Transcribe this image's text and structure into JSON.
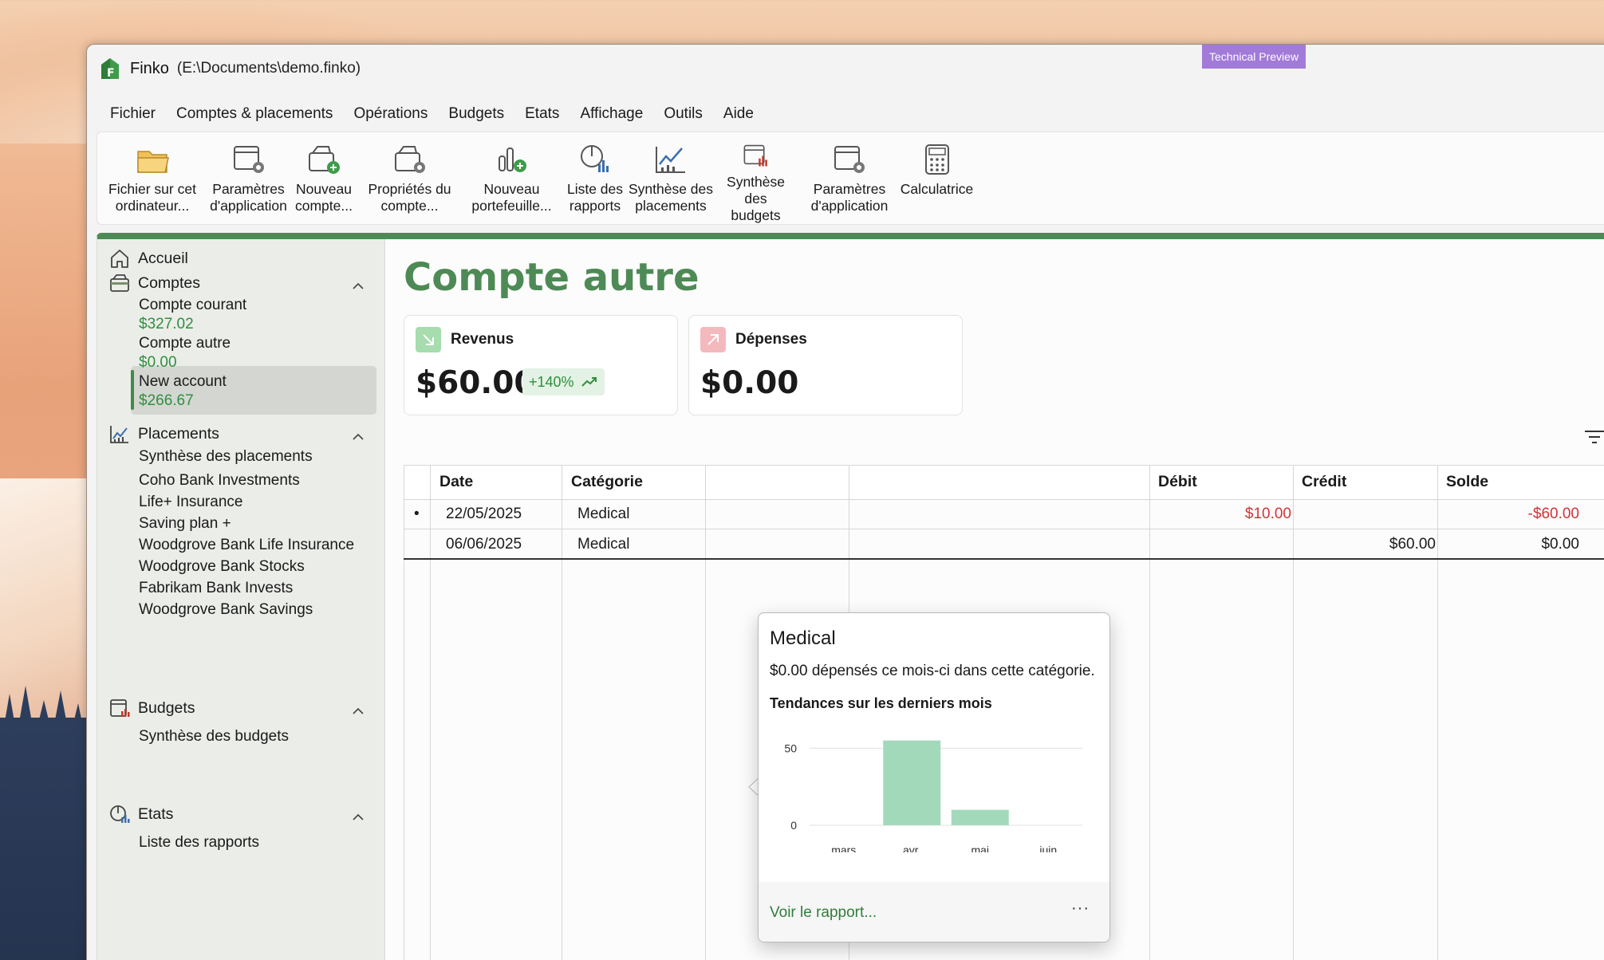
{
  "window": {
    "app_name": "Finko",
    "file_path": "(E:\\Documents\\demo.finko)",
    "badge": "Technical Preview"
  },
  "menu": [
    "Fichier",
    "Comptes & placements",
    "Opérations",
    "Budgets",
    "Etats",
    "Affichage",
    "Outils",
    "Aide"
  ],
  "ribbon": [
    {
      "label": "Fichier sur cet\nordinateur...",
      "icon": "folder-icon"
    },
    {
      "label": "Paramètres\nd'application",
      "icon": "window-gear-icon"
    },
    {
      "label": "Nouveau\ncompte...",
      "icon": "wallet-add-icon"
    },
    {
      "label": "Propriétés du\ncompte...",
      "icon": "wallet-gear-icon"
    },
    {
      "label": "Nouveau\nportefeuille...",
      "icon": "portfolio-add-icon"
    },
    {
      "label": "Liste des\nrapports",
      "icon": "report-chart-icon"
    },
    {
      "label": "Synthèse des\nplacements",
      "icon": "trend-chart-icon"
    },
    {
      "label": "Synthèse des\nbudgets",
      "icon": "budget-chart-icon"
    },
    {
      "label": "Paramètres\nd'application",
      "icon": "window-gear-icon"
    },
    {
      "label": "Calculatrice",
      "icon": "calculator-icon"
    }
  ],
  "sidebar": {
    "home": "Accueil",
    "accounts_title": "Comptes",
    "accounts": [
      {
        "name": "Compte courant",
        "balance": "$327.02"
      },
      {
        "name": "Compte autre",
        "balance": "$0.00"
      },
      {
        "name": "New account",
        "balance": "$266.67"
      }
    ],
    "investments_title": "Placements",
    "investments": [
      "Synthèse des placements",
      "Coho Bank Investments",
      "Life+ Insurance",
      "Saving plan +",
      "Woodgrove Bank Life Insurance",
      "Woodgrove Bank Stocks",
      "Fabrikam Bank Invests",
      "Woodgrove Bank Savings"
    ],
    "budgets_title": "Budgets",
    "budgets": [
      "Synthèse des budgets"
    ],
    "reports_title": "Etats",
    "reports": [
      "Liste des rapports"
    ]
  },
  "page": {
    "title": "Compte autre",
    "income": {
      "title": "Revenus",
      "amount": "$60.00",
      "change": "+140%"
    },
    "expense": {
      "title": "Dépenses",
      "amount": "$0.00"
    }
  },
  "table": {
    "headers": {
      "date": "Date",
      "category": "Catégorie",
      "debit": "Débit",
      "credit": "Crédit",
      "balance": "Solde"
    },
    "rows": [
      {
        "marker": "•",
        "date": "22/05/2025",
        "category": "Medical",
        "debit": "$10.00",
        "credit": "",
        "balance": "-$60.00"
      },
      {
        "marker": "",
        "date": "06/06/2025",
        "category": "Medical",
        "debit": "",
        "credit": "$60.00",
        "balance": "$0.00"
      }
    ]
  },
  "popup": {
    "title": "Medical",
    "description": "$0.00 dépensés ce mois-ci dans cette catégorie.",
    "subtitle": "Tendances sur les derniers mois",
    "link": "Voir le rapport...",
    "more": "···"
  },
  "chart_data": {
    "type": "bar",
    "title": "Tendances sur les derniers mois",
    "categories": [
      "mars",
      "avr.",
      "mai",
      "juin"
    ],
    "values": [
      0,
      55,
      10,
      0
    ],
    "yticks": [
      0,
      50
    ],
    "ylim": [
      0,
      60
    ],
    "color": "#a3d9bb",
    "grid": true
  },
  "colors": {
    "accent": "#4e8a55",
    "positive": "#2f8f3e",
    "negative": "#d13438",
    "badge": "#a27ad8"
  }
}
